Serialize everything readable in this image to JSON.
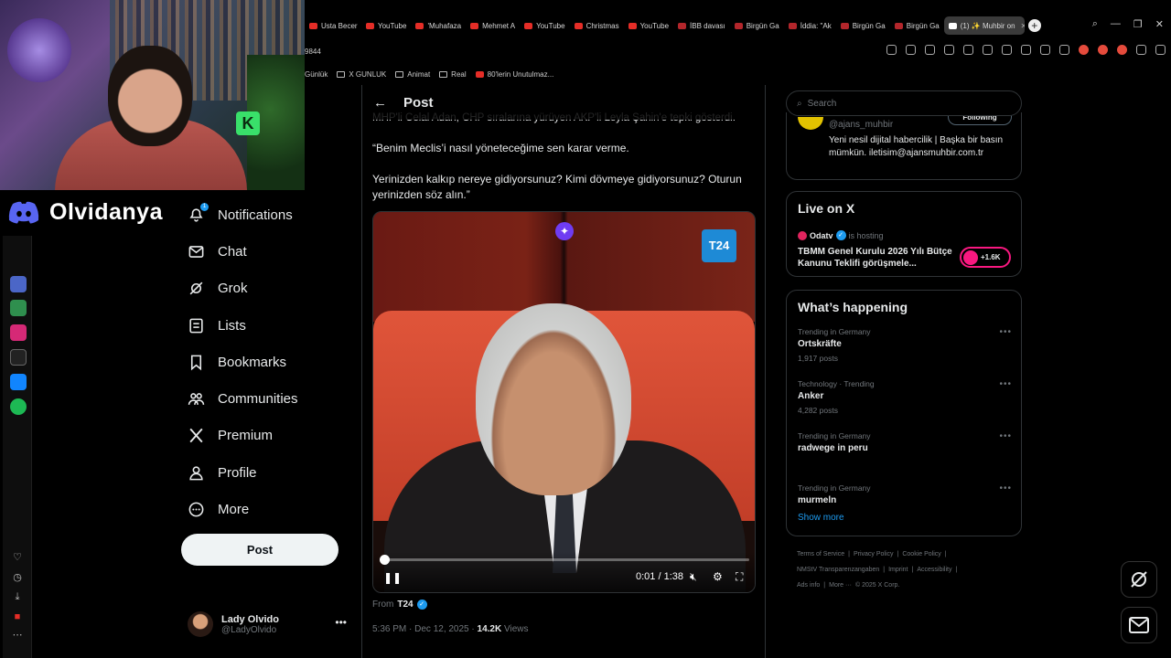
{
  "overlay": {
    "channel_name": "Olvidanya"
  },
  "browser": {
    "tabs": [
      {
        "label": "Usta Becer",
        "fav": "#e52d27"
      },
      {
        "label": "YouTube",
        "fav": "#e52d27"
      },
      {
        "label": "'Muhafaza",
        "fav": "#e52d27"
      },
      {
        "label": "Mehmet A",
        "fav": "#e52d27"
      },
      {
        "label": "YouTube",
        "fav": "#e52d27"
      },
      {
        "label": "Christmas",
        "fav": "#e52d27"
      },
      {
        "label": "YouTube",
        "fav": "#e52d27"
      },
      {
        "label": "İBB davası",
        "fav": "#b3262b"
      },
      {
        "label": "Birgün Ga",
        "fav": "#b3262b"
      },
      {
        "label": "İddia: \"Ak",
        "fav": "#b3262b"
      },
      {
        "label": "Birgün Ga",
        "fav": "#b3262b"
      },
      {
        "label": "Birgün Ga",
        "fav": "#b3262b"
      },
      {
        "label": "(1) ✨ Muhbir on",
        "fav": "#ffffff",
        "active": true
      }
    ],
    "address_fragment": "9844",
    "bookmarks": [
      {
        "label": "Günlük",
        "type": "text"
      },
      {
        "label": "X GUNLUK",
        "type": "folder"
      },
      {
        "label": "Animat",
        "type": "folder"
      },
      {
        "label": "Real",
        "type": "folder"
      },
      {
        "label": "80'lerin Unutulmaz...",
        "type": "youtube"
      }
    ]
  },
  "nav": {
    "items": [
      {
        "label": "Notifications",
        "icon": "bell-icon"
      },
      {
        "label": "Chat",
        "icon": "mail-icon"
      },
      {
        "label": "Grok",
        "icon": "grok-icon"
      },
      {
        "label": "Lists",
        "icon": "list-icon"
      },
      {
        "label": "Bookmarks",
        "icon": "bookmark-icon"
      },
      {
        "label": "Communities",
        "icon": "communities-icon"
      },
      {
        "label": "Premium",
        "icon": "x-logo-icon"
      },
      {
        "label": "Profile",
        "icon": "person-icon"
      },
      {
        "label": "More",
        "icon": "more-circle-icon"
      }
    ],
    "notification_badge": "1",
    "post_button": "Post",
    "account": {
      "name": "Lady Olvido",
      "handle": "@LadyOlvido"
    }
  },
  "post": {
    "header_title": "Post",
    "cut_line": "MHP'li Celal Adan, CHP sıralarına yürüyen AKP'li Leyla Şahin'e tepki gösterdi.",
    "quote": "“Benim Meclis’i nasıl yöneteceğime sen karar verme.",
    "quote2": "Yerinizden kalkıp nereye gidiyorsunuz? Kimi dövmeye gidiyorsunuz? Oturun yerinizden söz alın.”",
    "video": {
      "brand_badge": "T24",
      "time": "0:01 / 1:38",
      "progress": 0.0106
    },
    "from_label": "From",
    "from_source": "T24",
    "timestamp": "5:36 PM · Dec 12, 2025 ·",
    "views_count": "14.2K",
    "views_label": "Views"
  },
  "sidebar": {
    "search_placeholder": "Search",
    "profile_card": {
      "handle": "@ajans_muhbir",
      "follow_label": "Following",
      "bio": "Yeni nesil dijital habercilik | Başka bir basın mümkün. iletisim@ajansmuhbir.com.tr"
    },
    "live": {
      "title": "Live on X",
      "host_name": "Odatv",
      "host_suffix": "is hosting",
      "broadcast_title": "TBMM Genel Kurulu 2026 Yılı Bütçe Kanunu Teklifi görüşmele...",
      "listeners": "+1.6K"
    },
    "happening": {
      "title": "What’s happening",
      "trends": [
        {
          "context": "Trending in Germany",
          "title": "Ortskräfte",
          "count": "1,917 posts"
        },
        {
          "context": "Technology · Trending",
          "title": "Anker",
          "count": "4,282 posts"
        },
        {
          "context": "Trending in Germany",
          "title": "radwege in peru",
          "count": ""
        },
        {
          "context": "Trending in Germany",
          "title": "murmeln",
          "count": ""
        }
      ],
      "show_more": "Show more"
    },
    "footer": {
      "links": [
        "Terms of Service",
        "|",
        "Privacy Policy",
        "|",
        "Cookie Policy",
        "|",
        "NMStV Transparenzangaben",
        "|",
        "Imprint",
        "|",
        "Accessibility",
        "|",
        "Ads info",
        "|",
        "More ···",
        "© 2025 X Corp."
      ]
    }
  }
}
